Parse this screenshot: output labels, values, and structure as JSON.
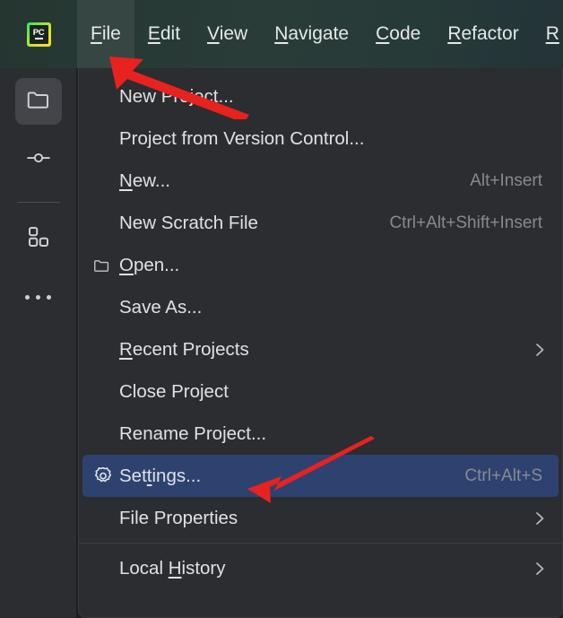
{
  "app": {
    "name": "PyCharm",
    "logo_text": "PC",
    "accent_green": "#8FE53B",
    "menubar_bg": "#2A3C38",
    "menu_bg": "#2B2D30",
    "highlight_bg": "#2E4270",
    "text_color": "#DFE1E5",
    "accel_color": "#868A91"
  },
  "menubar": {
    "items": [
      {
        "label": "File",
        "mnemonic": "F",
        "active": true
      },
      {
        "label": "Edit",
        "mnemonic": "E",
        "active": false
      },
      {
        "label": "View",
        "mnemonic": "V",
        "active": false
      },
      {
        "label": "Navigate",
        "mnemonic": "N",
        "active": false
      },
      {
        "label": "Code",
        "mnemonic": "C",
        "active": false
      },
      {
        "label": "Refactor",
        "mnemonic": "R",
        "active": false
      },
      {
        "label": "R",
        "mnemonic": "R",
        "active": false
      }
    ]
  },
  "sidebar": {
    "items": [
      {
        "name": "project-tool-window",
        "icon": "folder-icon",
        "selected": true
      },
      {
        "name": "commit-tool-window",
        "icon": "commit-icon",
        "selected": false
      },
      {
        "name": "structure-tool-window",
        "icon": "blocks-icon",
        "selected": false
      },
      {
        "name": "more-tool-windows",
        "icon": "ellipsis-icon",
        "selected": false
      }
    ]
  },
  "file_menu": {
    "items": [
      {
        "label": "New Project...",
        "accel": "",
        "icon": "",
        "submenu": false,
        "highlighted": false,
        "mnemonic_index": -1
      },
      {
        "label": "Project from Version Control...",
        "accel": "",
        "icon": "",
        "submenu": false,
        "highlighted": false,
        "mnemonic_index": -1
      },
      {
        "label": "New...",
        "accel": "Alt+Insert",
        "icon": "",
        "submenu": false,
        "highlighted": false,
        "mnemonic_index": 0
      },
      {
        "label": "New Scratch File",
        "accel": "Ctrl+Alt+Shift+Insert",
        "icon": "",
        "submenu": false,
        "highlighted": false,
        "mnemonic_index": -1
      },
      {
        "label": "Open...",
        "accel": "",
        "icon": "folder-icon",
        "submenu": false,
        "highlighted": false,
        "mnemonic_index": 0
      },
      {
        "label": "Save As...",
        "accel": "",
        "icon": "",
        "submenu": false,
        "highlighted": false,
        "mnemonic_index": -1
      },
      {
        "label": "Recent Projects",
        "accel": "",
        "icon": "",
        "submenu": true,
        "highlighted": false,
        "mnemonic_index": 0
      },
      {
        "label": "Close Project",
        "accel": "",
        "icon": "",
        "submenu": false,
        "highlighted": false,
        "mnemonic_index": -1
      },
      {
        "label": "Rename Project...",
        "accel": "",
        "icon": "",
        "submenu": false,
        "highlighted": false,
        "mnemonic_index": -1
      },
      {
        "label": "Settings...",
        "accel": "Ctrl+Alt+S",
        "icon": "gear-icon",
        "submenu": false,
        "highlighted": true,
        "mnemonic_index": 3
      },
      {
        "label": "File Properties",
        "accel": "",
        "icon": "",
        "submenu": true,
        "highlighted": false,
        "mnemonic_index": -1
      },
      {
        "label": "Local History",
        "accel": "",
        "icon": "",
        "submenu": true,
        "highlighted": false,
        "mnemonic_index": 6
      }
    ]
  },
  "annotations": {
    "arrow_color": "#E8221E",
    "arrows": [
      {
        "name": "arrow-to-file-menu",
        "points_to": "File"
      },
      {
        "name": "arrow-to-settings-item",
        "points_to": "Settings..."
      }
    ]
  }
}
